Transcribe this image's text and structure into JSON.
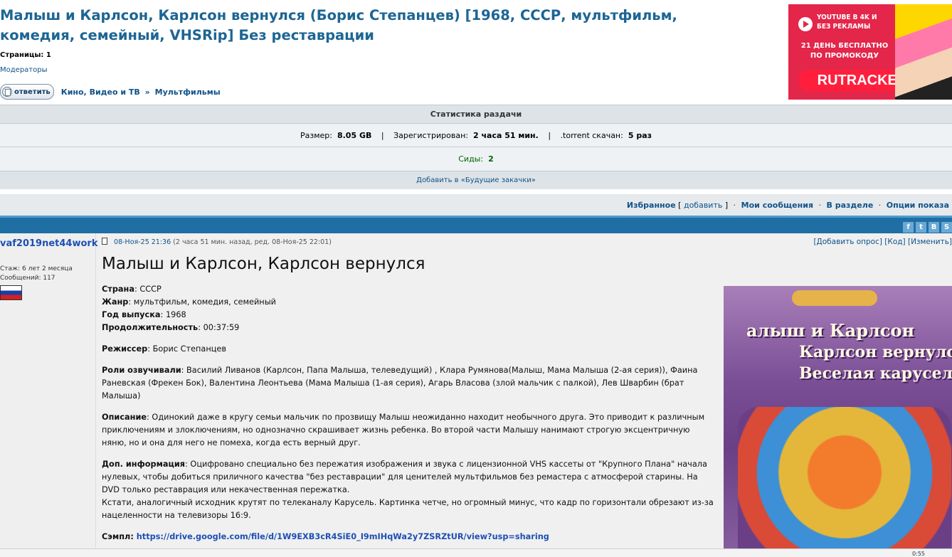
{
  "topic": {
    "title": "Малыш и Карлсон, Карлсон вернулся (Борис Степанцев) [1968, СССР, мультфильм, комедия, семейный, VHSRip] Без реставрации",
    "pages_label": "Страницы:",
    "pages_value": "1",
    "moderators": "Модераторы",
    "reply_label": "ответить",
    "crumb_1": "Кино, Видео и ТВ",
    "crumb_sep": "»",
    "crumb_2": "Мультфильмы"
  },
  "ad": {
    "line1": "YOUTUBE В 4K И БЕЗ РЕКЛАМЫ",
    "line2": "21 ДЕНЬ БЕСПЛАТНО ПО ПРОМОКОДУ",
    "brand": "RUTRACKER"
  },
  "stats": {
    "header": "Статистика раздачи",
    "size_label": "Размер:",
    "size_value": "8.05 GB",
    "sep": "|",
    "registered_label": "Зарегистрирован:",
    "registered_value": "2 часа 51 мин.",
    "downloaded_label": ".torrent скачан:",
    "downloaded_value": "5 раз",
    "seeds_label": "Сиды:",
    "seeds_value": "2",
    "future_link": "Добавить в «Будущие закачки»"
  },
  "subnav": {
    "favorites": "Избранное",
    "add_open": "[",
    "add": "добавить",
    "add_close": "]",
    "dot": "·",
    "my_messages": "Мои сообщения",
    "in_section": "В разделе",
    "display_options": "Опции показа"
  },
  "post": {
    "author": {
      "nick": "vaf2019net44work",
      "tenure": "Стаж: 6 лет 2 месяца",
      "messages": "Сообщений: 117"
    },
    "date": "08-Ноя-25 21:36",
    "date_meta": "(2 часа 51 мин. назад, ред. 08-Ноя-25 22:01)",
    "actions": "[Добавить опрос] [Код] [Изменить]",
    "title": "Малыш и Карлсон, Карлсон вернулся",
    "country_label": "Страна",
    "country": ": СССР",
    "genre_label": "Жанр",
    "genre": ": мультфильм, комедия, семейный",
    "year_label": "Год выпуска",
    "year": ": 1968",
    "duration_label": "Продолжительность",
    "duration": ": 00:37:59",
    "director_label": "Режиссер",
    "director": ": Борис Степанцев",
    "voices_label": "Роли озвучивали",
    "voices": ": Василий Ливанов (Карлсон, Папа Малыша, телеведущий) , Клара Румянова(Малыш, Мама Малыша (2-ая серия)), Фаина Раневская (Фрекен Бок), Валентина Леонтьева (Мама Малыша (1-ая серия), Агарь Власова (злой мальчик с палкой), Лев Шварбин (брат Малыша)",
    "description_label": "Описание",
    "description": ": Одинокий даже в кругу семьи мальчик по прозвищу Малыш неожиданно находит необычного друга. Это приводит к различным приключениям и злоключениям, но однозначно скрашивает жизнь ребенка. Во второй части Малышу нанимают строгую эксцентричную няню, но и она для него не помеха, когда есть верный друг.",
    "extra_label": "Доп. информация",
    "extra": ": Оцифровано специально без пережатия изображения и звука с лицензионной VHS кассеты от \"Крупного Плана\" начала нулевых, чтобы добиться приличного качества \"без реставрации\" для ценителей мультфильмов без ремастера с атмосферой старины. На DVD только реставрация или некачественная пережатка.",
    "extra_2": "Кстати, аналогичный исходник крутят по телеканалу Карусель. Картинка четче, но огромный минус, что кадр по горизонтали обрезают из-за нацеленности на телевизоры 16:9.",
    "sample_label": "Сэмпл",
    "sample_sep": ": ",
    "sample_url": "https://drive.google.com/file/d/1W9EXB3cR4SiE0_I9mIHqWa2y7ZSRZtUR/view?usp=sharing"
  },
  "cover": {
    "title_1": "алыш и Карлсон",
    "title_2": "Карлсон вернулся",
    "title_3": "Веселая карусель"
  },
  "taskbar": {
    "time": "0:55"
  }
}
